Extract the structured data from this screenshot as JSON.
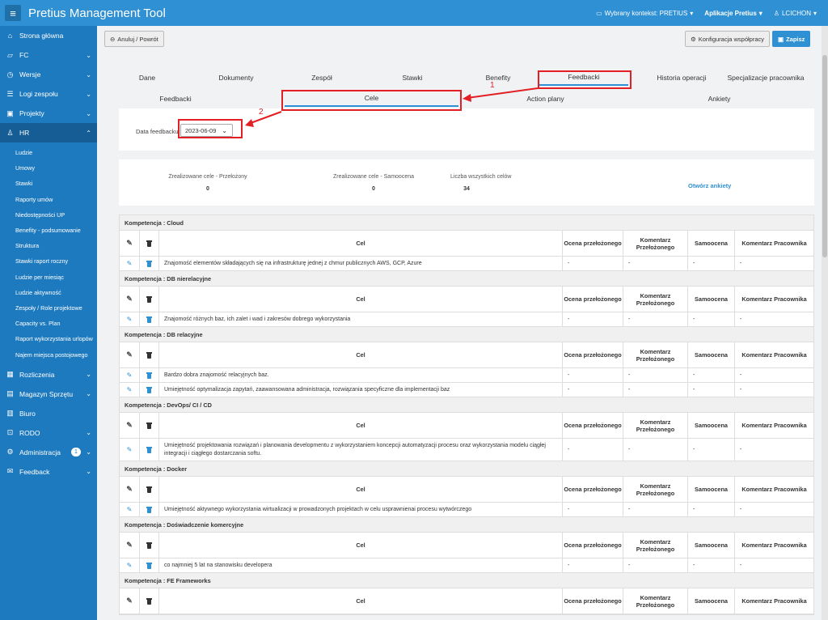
{
  "app": {
    "title": "Pretius Management Tool"
  },
  "topbar": {
    "context": "Wybrany kontekst: PRETIUS",
    "apps": "Aplikacje Pretius",
    "user": "LCICHON"
  },
  "sidebar": {
    "items": [
      {
        "label": "Strona główna",
        "icon": "home-icon"
      },
      {
        "label": "FC",
        "icon": "chart-icon"
      },
      {
        "label": "Wersje",
        "icon": "history-icon"
      },
      {
        "label": "Logi zespołu",
        "icon": "list-icon"
      },
      {
        "label": "Projekty",
        "icon": "briefcase-icon"
      },
      {
        "label": "HR",
        "icon": "users-icon"
      }
    ],
    "hr_sub": [
      "Ludzie",
      "Umowy",
      "Stawki",
      "Raporty umów",
      "Niedostępności UP",
      "Benefity - podsumowanie",
      "Struktura",
      "Stawki raport roczny",
      "Ludzie per miesiąc",
      "Ludzie aktywność",
      "Zespoły / Role projektowe",
      "Capacity vs. Plan",
      "Raport wykorzystania urlopów",
      "Najem miejsca postojowego"
    ],
    "items2": [
      {
        "label": "Rozliczenia",
        "icon": "calculator-icon",
        "chev": true
      },
      {
        "label": "Magazyn Sprzętu",
        "icon": "box-icon",
        "chev": true
      },
      {
        "label": "Biuro",
        "icon": "building-icon",
        "chev": false
      },
      {
        "label": "RODO",
        "icon": "lock-icon",
        "chev": true
      },
      {
        "label": "Administracja",
        "icon": "gear-icon",
        "chev": true,
        "badge": "1"
      },
      {
        "label": "Feedback",
        "icon": "comment-icon",
        "chev": true
      }
    ]
  },
  "toolbar": {
    "cancel": "Anuluj / Powrót",
    "config": "Konfiguracja współpracy",
    "save": "Zapisz"
  },
  "tabs1": [
    "Dane",
    "Dokumenty",
    "Zespół",
    "Stawki",
    "Benefity",
    "Feedbacki",
    "Historia operacji",
    "Specjalizacje pracownika"
  ],
  "tabs2": [
    "Feedbacki",
    "Cele",
    "Action plany",
    "Ankiety"
  ],
  "annotations": {
    "one": "1",
    "two": "2"
  },
  "filter": {
    "label": "Data feedbacku",
    "value": "2023-06-09"
  },
  "stats": {
    "a_label": "Zrealizowane cele - Przełożony",
    "a_value": "0",
    "b_label": "Zrealizowane cele - Samoocena",
    "b_value": "0",
    "c_label": "Liczba wszystkich celów",
    "c_value": "34",
    "link": "Otwórz ankiety"
  },
  "table": {
    "headers": {
      "cel": "Cel",
      "ocena": "Ocena przełożonego",
      "komentarz_p": "Komentarz Przełożonego",
      "samoocena": "Samoocena",
      "komentarz_pr": "Komentarz Pracownika"
    },
    "sections": [
      {
        "title": "Kompetencja : Cloud",
        "rows": [
          "Znajomość elementów składających się na infrastrukturę jednej z chmur publicznych AWS, GCP, Azure"
        ]
      },
      {
        "title": "Kompetencja : DB nierelacyjne",
        "rows": [
          "Znajomość różnych baz, ich zalet i wad i zakresów dobrego wykorzystania"
        ]
      },
      {
        "title": "Kompetencja : DB relacyjne",
        "rows": [
          "Bardzo dobra znajomość relacyjnych baz.",
          "Umiejętność optymalizacja zapytań, zaawansowana administracja, rozwiązania specyficzne dla implementacji baz"
        ]
      },
      {
        "title": "Kompetencja : DevOps/ CI / CD",
        "rows": [
          "Umiejętność projektowania rozwiązań i planowania developmentu z wykorzystaniem koncepcji automatyzacji procesu oraz wykorzystania modelu ciągłej integracji i ciągłego dostarczania softu."
        ]
      },
      {
        "title": "Kompetencja : Docker",
        "rows": [
          "Umiejętność aktywnego wykorzystania wirtualizacji w prowadzonych projektach w celu usprawnienai procesu wytwórczego"
        ]
      },
      {
        "title": "Kompetencja : Doświadczenie komercyjne",
        "rows": [
          "co najmniej 5 lat na stanowisku developera"
        ]
      },
      {
        "title": "Kompetencja : FE Frameworks",
        "rows": []
      }
    ],
    "dash": "-"
  }
}
